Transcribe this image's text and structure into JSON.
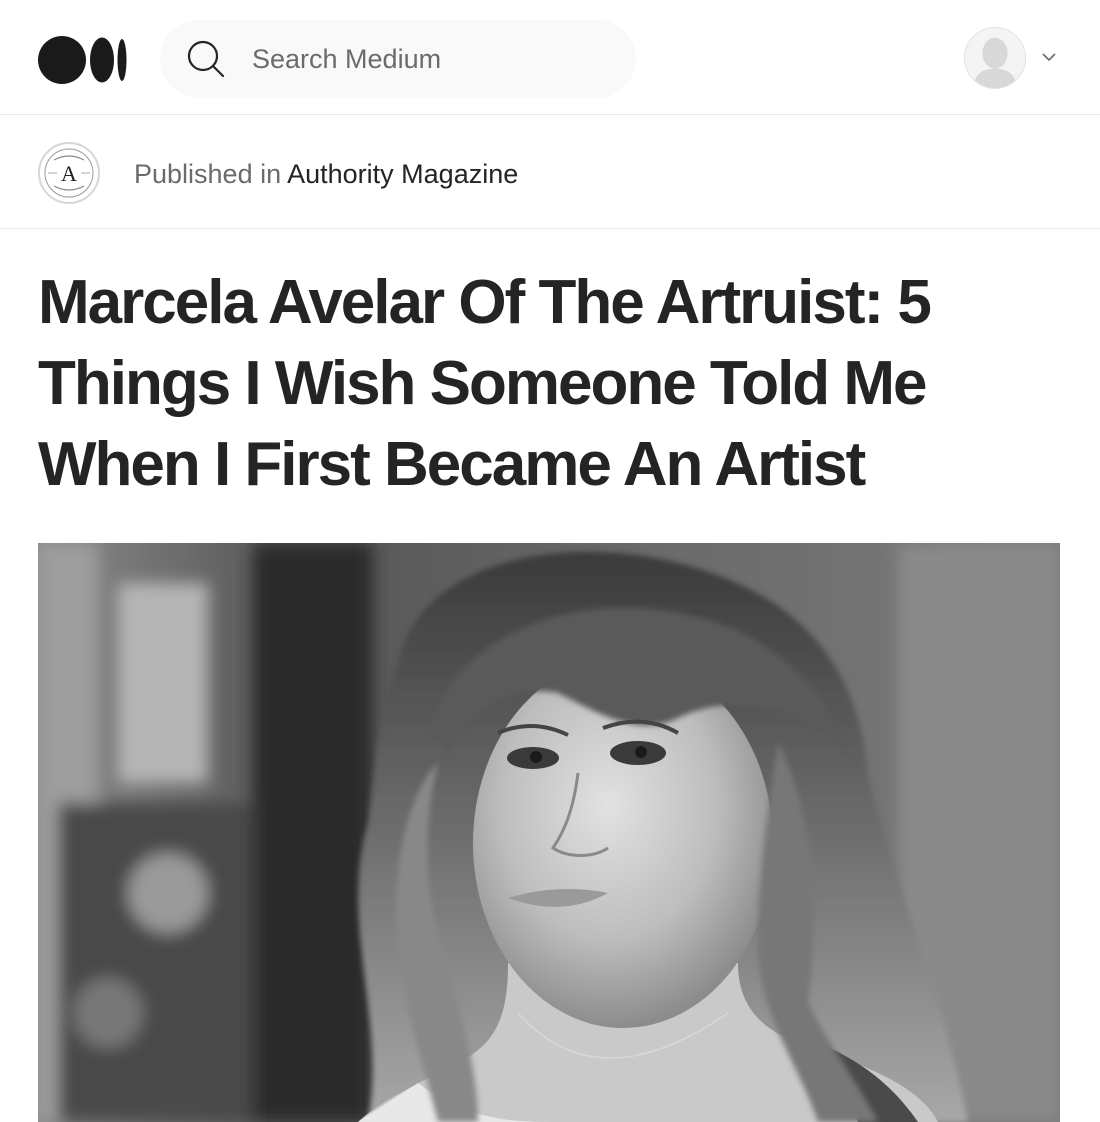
{
  "header": {
    "logo_icon": "medium-logo-icon",
    "search": {
      "placeholder": "Search Medium",
      "icon": "search-icon"
    },
    "avatar_icon": "user-avatar-icon",
    "menu_icon": "chevron-down-icon"
  },
  "publication": {
    "prefix": "Published in",
    "name": "Authority Magazine",
    "logo_letter": "A"
  },
  "article": {
    "title": "Marcela Avelar Of The Artruist: 5 Things I Wish Someone Told Me When I First Became An Artist",
    "hero_image": "black-and-white portrait photo"
  },
  "colors": {
    "text": "#242424",
    "muted": "#6b6b6b",
    "search_bg": "#f9f9f9",
    "divider": "#e8e8e8"
  }
}
